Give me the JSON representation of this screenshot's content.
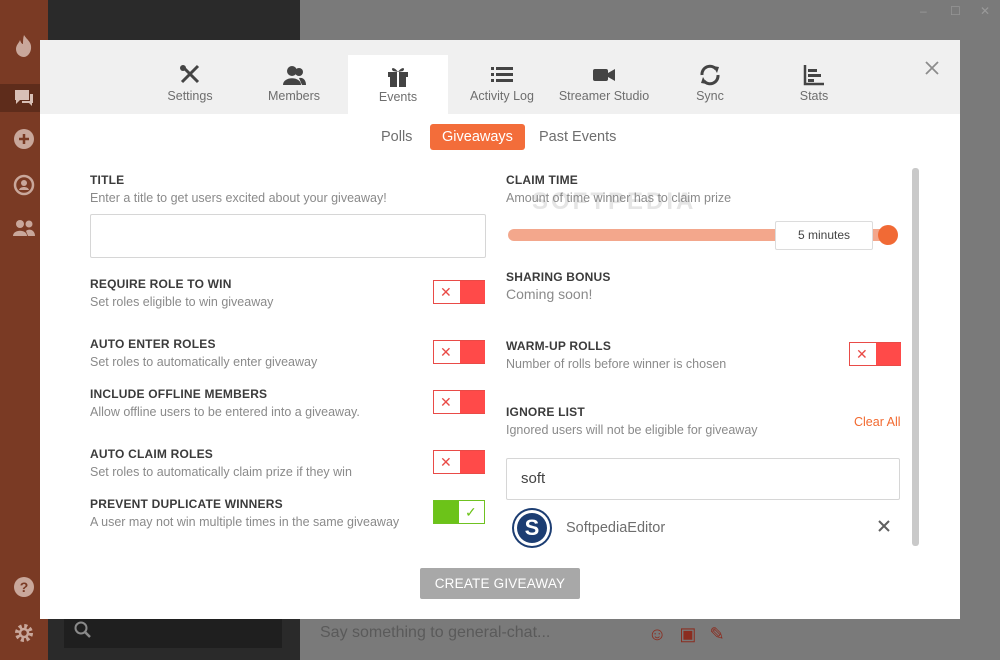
{
  "window": {
    "min_glyph": "–",
    "max_glyph": "☐",
    "close_glyph": "✕"
  },
  "tabs": [
    {
      "label": "Settings",
      "icon": "wrench-icon"
    },
    {
      "label": "Members",
      "icon": "members-icon"
    },
    {
      "label": "Events",
      "icon": "gift-icon",
      "active": true
    },
    {
      "label": "Activity Log",
      "icon": "list-icon"
    },
    {
      "label": "Streamer Studio",
      "icon": "video-camera-icon"
    },
    {
      "label": "Sync",
      "icon": "sync-icon"
    },
    {
      "label": "Stats",
      "icon": "bar-chart-icon"
    }
  ],
  "subtabs": {
    "polls": "Polls",
    "giveaways": "Giveaways",
    "past_events": "Past Events",
    "active": "Giveaways"
  },
  "left": {
    "title": {
      "label": "TITLE",
      "desc": "Enter a title to get users excited about your giveaway!",
      "value": ""
    },
    "require_role": {
      "label": "REQUIRE ROLE TO WIN",
      "desc": "Set roles eligible to win giveaway",
      "enabled": false
    },
    "auto_enter": {
      "label": "AUTO ENTER ROLES",
      "desc": "Set roles to automatically enter giveaway",
      "enabled": false
    },
    "include_offline": {
      "label": "INCLUDE OFFLINE MEMBERS",
      "desc": "Allow offline users to be entered into a giveaway.",
      "enabled": false
    },
    "auto_claim": {
      "label": "AUTO CLAIM ROLES",
      "desc": "Set roles to automatically claim prize if they win",
      "enabled": false
    },
    "prevent_duplicate": {
      "label": "PREVENT DUPLICATE WINNERS",
      "desc": "A user may not win multiple times in the same giveaway",
      "enabled": true
    }
  },
  "right": {
    "claim_time": {
      "label": "CLAIM TIME",
      "desc": "Amount of time winner has to claim prize",
      "value_label": "5 minutes",
      "level": 1.0
    },
    "sharing_bonus": {
      "label": "SHARING BONUS",
      "value": "Coming soon!"
    },
    "warmup": {
      "label": "WARM-UP ROLLS",
      "desc": "Number of rolls before winner is chosen",
      "enabled": false
    },
    "ignore_list": {
      "label": "IGNORE LIST",
      "desc": "Ignored users will not be eligible for giveaway",
      "clear_all": "Clear All",
      "search_value": "soft",
      "results": [
        {
          "name": "SoftpediaEditor",
          "avatar_letter": "S"
        }
      ]
    }
  },
  "create_button": "CREATE GIVEAWAY",
  "toggle_glyphs": {
    "off": "✕",
    "on": "✓"
  },
  "watermark": "SOFTPEDIA",
  "chat": {
    "placeholder": "Say something to general-chat..."
  },
  "colors": {
    "accent": "#f36d3a",
    "toggle_off": "#ff4a49",
    "toggle_on": "#6cc319",
    "sidebar": "#7a3a24"
  }
}
